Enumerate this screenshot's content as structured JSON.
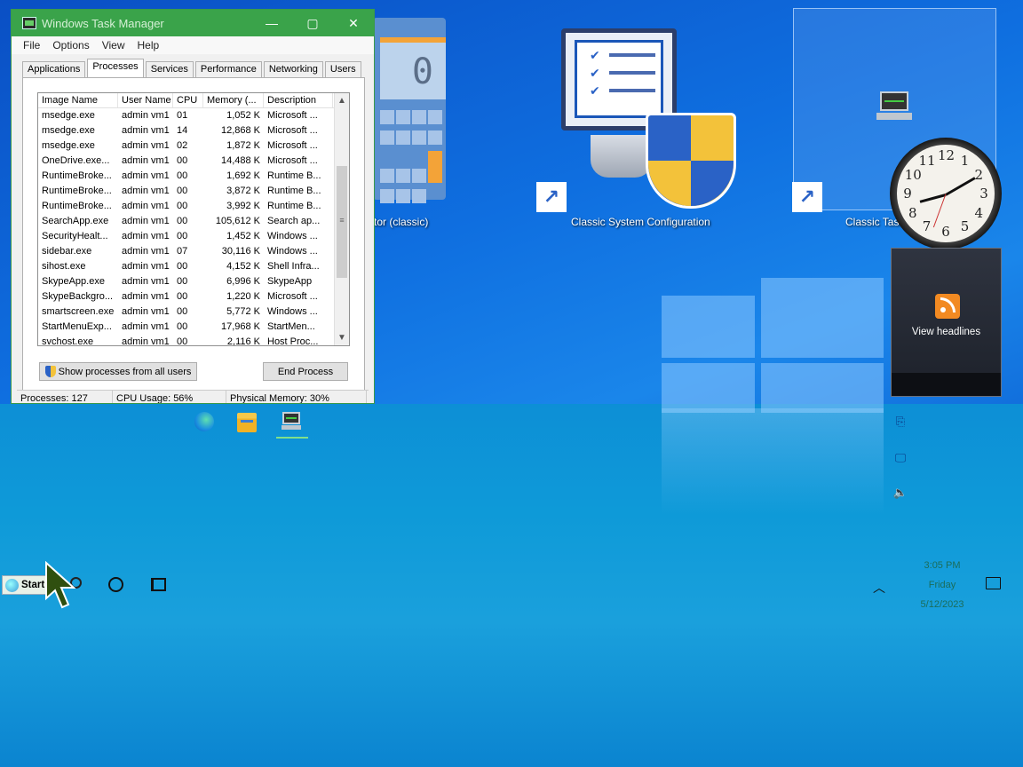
{
  "window": {
    "title": "Windows Task Manager",
    "menu": [
      "File",
      "Options",
      "View",
      "Help"
    ],
    "tabs": [
      "Applications",
      "Processes",
      "Services",
      "Performance",
      "Networking",
      "Users"
    ],
    "active_tab": "Processes",
    "columns": [
      "Image Name",
      "User Name",
      "CPU",
      "Memory (...",
      "Description"
    ],
    "rows": [
      [
        "msedge.exe",
        "admin vm1",
        "01",
        "1,052 K",
        "Microsoft ..."
      ],
      [
        "msedge.exe",
        "admin vm1",
        "14",
        "12,868 K",
        "Microsoft ..."
      ],
      [
        "msedge.exe",
        "admin vm1",
        "02",
        "1,872 K",
        "Microsoft ..."
      ],
      [
        "OneDrive.exe...",
        "admin vm1",
        "00",
        "14,488 K",
        "Microsoft ..."
      ],
      [
        "RuntimeBroke...",
        "admin vm1",
        "00",
        "1,692 K",
        "Runtime B..."
      ],
      [
        "RuntimeBroke...",
        "admin vm1",
        "00",
        "3,872 K",
        "Runtime B..."
      ],
      [
        "RuntimeBroke...",
        "admin vm1",
        "00",
        "3,992 K",
        "Runtime B..."
      ],
      [
        "SearchApp.exe",
        "admin vm1",
        "00",
        "105,612 K",
        "Search ap..."
      ],
      [
        "SecurityHealt...",
        "admin vm1",
        "00",
        "1,452 K",
        "Windows ..."
      ],
      [
        "sidebar.exe",
        "admin vm1",
        "07",
        "30,116 K",
        "Windows ..."
      ],
      [
        "sihost.exe",
        "admin vm1",
        "00",
        "4,152 K",
        "Shell Infra..."
      ],
      [
        "SkypeApp.exe",
        "admin vm1",
        "00",
        "6,996 K",
        "SkypeApp"
      ],
      [
        "SkypeBackgro...",
        "admin vm1",
        "00",
        "1,220 K",
        "Microsoft ..."
      ],
      [
        "smartscreen.exe",
        "admin vm1",
        "00",
        "5,772 K",
        "Windows ..."
      ],
      [
        "StartMenuExp...",
        "admin vm1",
        "00",
        "17,968 K",
        "StartMen..."
      ],
      [
        "svchost.exe",
        "admin vm1",
        "00",
        "2,116 K",
        "Host Proc..."
      ]
    ],
    "show_all_label": "Show processes from all users",
    "end_process_label": "End Process",
    "status": {
      "processes": "Processes: 127",
      "cpu": "CPU Usage: 56%",
      "memory": "Physical Memory: 30%"
    }
  },
  "desktop": {
    "calc_label": "tor (classic)",
    "sysconfig_label": "Classic System Configuration",
    "taskmgr_label": "Classic Task",
    "calc_display": "0",
    "rss_label": "View headlines"
  },
  "clock_gadget": {
    "numbers": [
      "12",
      "1",
      "2",
      "3",
      "4",
      "5",
      "6",
      "7",
      "8",
      "9",
      "10",
      "11"
    ]
  },
  "taskbar": {
    "start_label": "Start",
    "time": "3:05 PM",
    "day": "Friday",
    "date": "5/12/2023"
  },
  "colors": {
    "titlebar": "#3aa34a",
    "desktop_blue": "#0f6fe0",
    "taskbar_area": "#0e9ad8"
  }
}
